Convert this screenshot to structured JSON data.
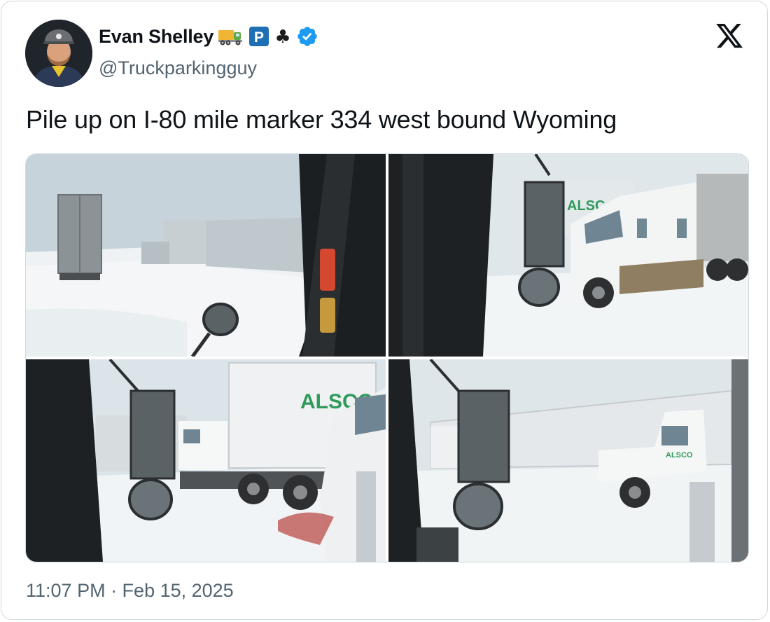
{
  "author": {
    "name": "Evan Shelley",
    "handle": "@Truckparkingguy",
    "verified": true,
    "name_emojis": [
      "truck-emoji",
      "parking-sign-emoji",
      "club-suit-emoji"
    ],
    "parking_letter": "P",
    "club_glyph": "♣"
  },
  "tweet": {
    "text": "Pile up on I-80 mile marker 334 west bound Wyoming",
    "timestamp": "11:07 PM · Feb 15, 2025"
  },
  "photos": {
    "count": 4,
    "trailer_brand": "ALSCO",
    "trailer_brand_short": "ALSC"
  },
  "colors": {
    "verified_blue": "#1d9bf0",
    "parking_blue": "#1f6fb5",
    "alsco_green": "#2f9a5c",
    "text_primary": "#0f1419",
    "text_secondary": "#536471",
    "border": "#cfd9de"
  }
}
